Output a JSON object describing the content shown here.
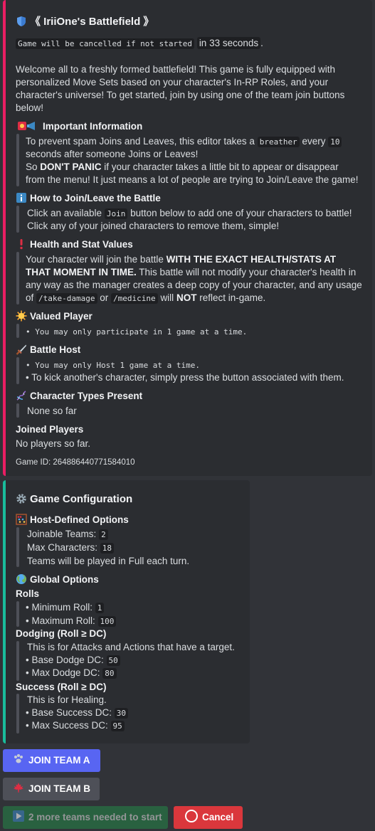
{
  "embed1": {
    "title": "《 IriiOne's Battlefield 》",
    "cancel_code": "Game will be cancelled if not started",
    "cancel_time": "in 33 seconds",
    "cancel_period": ".",
    "intro": [
      "Welcome all to a freshly formed battlefield! This game is fully equipped with",
      "personalized Move Sets based on your character's In-RP Roles, and your",
      "character's universe! To get started, join by using one of the team join buttons",
      "below!"
    ],
    "important": {
      "heading": "Important Information",
      "l1a": "To prevent spam Joins and Leaves, this editor takes a",
      "l1code": "breather",
      "l1b": "every",
      "l1num": "10",
      "l2": "seconds after someone Joins or Leaves!",
      "l3a": "So",
      "l3bold": "DON'T PANIC",
      "l3b": "if your character takes a little bit to appear or disappear",
      "l4": "from the menu! It just means a lot of people are trying to Join/Leave the game!"
    },
    "howto": {
      "heading": "How to Join/Leave the Battle",
      "l1a": "Click an available",
      "l1code": "Join",
      "l1b": "button below to add one of your characters to battle!",
      "l2": "Click any of your joined characters to remove them, simple!"
    },
    "health": {
      "heading": "Health and Stat Values",
      "l1a": "Your character will join the battle",
      "l1bold": "WITH THE EXACT HEALTH/STATS AT",
      "l2bold": "THAT MOMENT IN TIME.",
      "l2b": "This battle will not modify your character's health in",
      "l3": "any way as the manager creates a deep copy of your character, and any usage",
      "l4a": "of",
      "l4code1": "/take-damage",
      "l4b": "or",
      "l4code2": "/medicine",
      "l4c": "will",
      "l4bold": "NOT",
      "l4d": "reflect in-game."
    },
    "valued": {
      "heading": "Valued Player",
      "l1": "• You may only participate in 1 game at a time."
    },
    "host": {
      "heading": "Battle Host",
      "l1": "• You may only Host 1 game at a time.",
      "l2": "• To kick another's character, simply press the button associated with them."
    },
    "types": {
      "heading": "Character Types Present",
      "l1": "None so far"
    },
    "joined": {
      "heading": "Joined Players",
      "l1": "No players so far."
    },
    "footer": "Game ID: 264886440771584010"
  },
  "embed2": {
    "title": "Game Configuration",
    "host_opts": {
      "heading": "Host-Defined Options",
      "teams_label": "Joinable Teams:",
      "teams_val": "2",
      "chars_label": "Max Characters:",
      "chars_val": "18",
      "played": "Teams will be played in Full each turn."
    },
    "global": {
      "heading": "Global Options"
    },
    "rolls": {
      "heading": "Rolls",
      "min_label": "• Minimum Roll:",
      "min_val": "1",
      "max_label": "• Maximum Roll:",
      "max_val": "100"
    },
    "dodging": {
      "heading": "Dodging (Roll ≥ DC)",
      "desc": "This is for Attacks and Actions that have a target.",
      "base_label": "• Base Dodge DC:",
      "base_val": "50",
      "max_label": "• Max Dodge DC:",
      "max_val": "80"
    },
    "success": {
      "heading": "Success (Roll ≥ DC)",
      "desc": "This is for Healing.",
      "base_label": "• Base Success DC:",
      "base_val": "30",
      "max_label": "• Max Success DC:",
      "max_val": "95"
    }
  },
  "buttons": {
    "join_a": "JOIN TEAM A",
    "join_b": "JOIN TEAM B",
    "start": "2 more teams needed to start",
    "cancel": "Cancel"
  },
  "icons": {
    "title": "shield-icon",
    "important": "siren-megaphone-icon",
    "howto": "info-icon",
    "health": "exclamation-icon",
    "valued": "sun-icon",
    "host": "dagger-icon",
    "types": "dna-icon",
    "config": "gear-icon",
    "host_opts": "abacus-icon",
    "global": "globe-icon",
    "join_a": "paw-icon",
    "join_b": "maple-leaf-icon",
    "start": "play-icon",
    "cancel": "stop-icon"
  }
}
